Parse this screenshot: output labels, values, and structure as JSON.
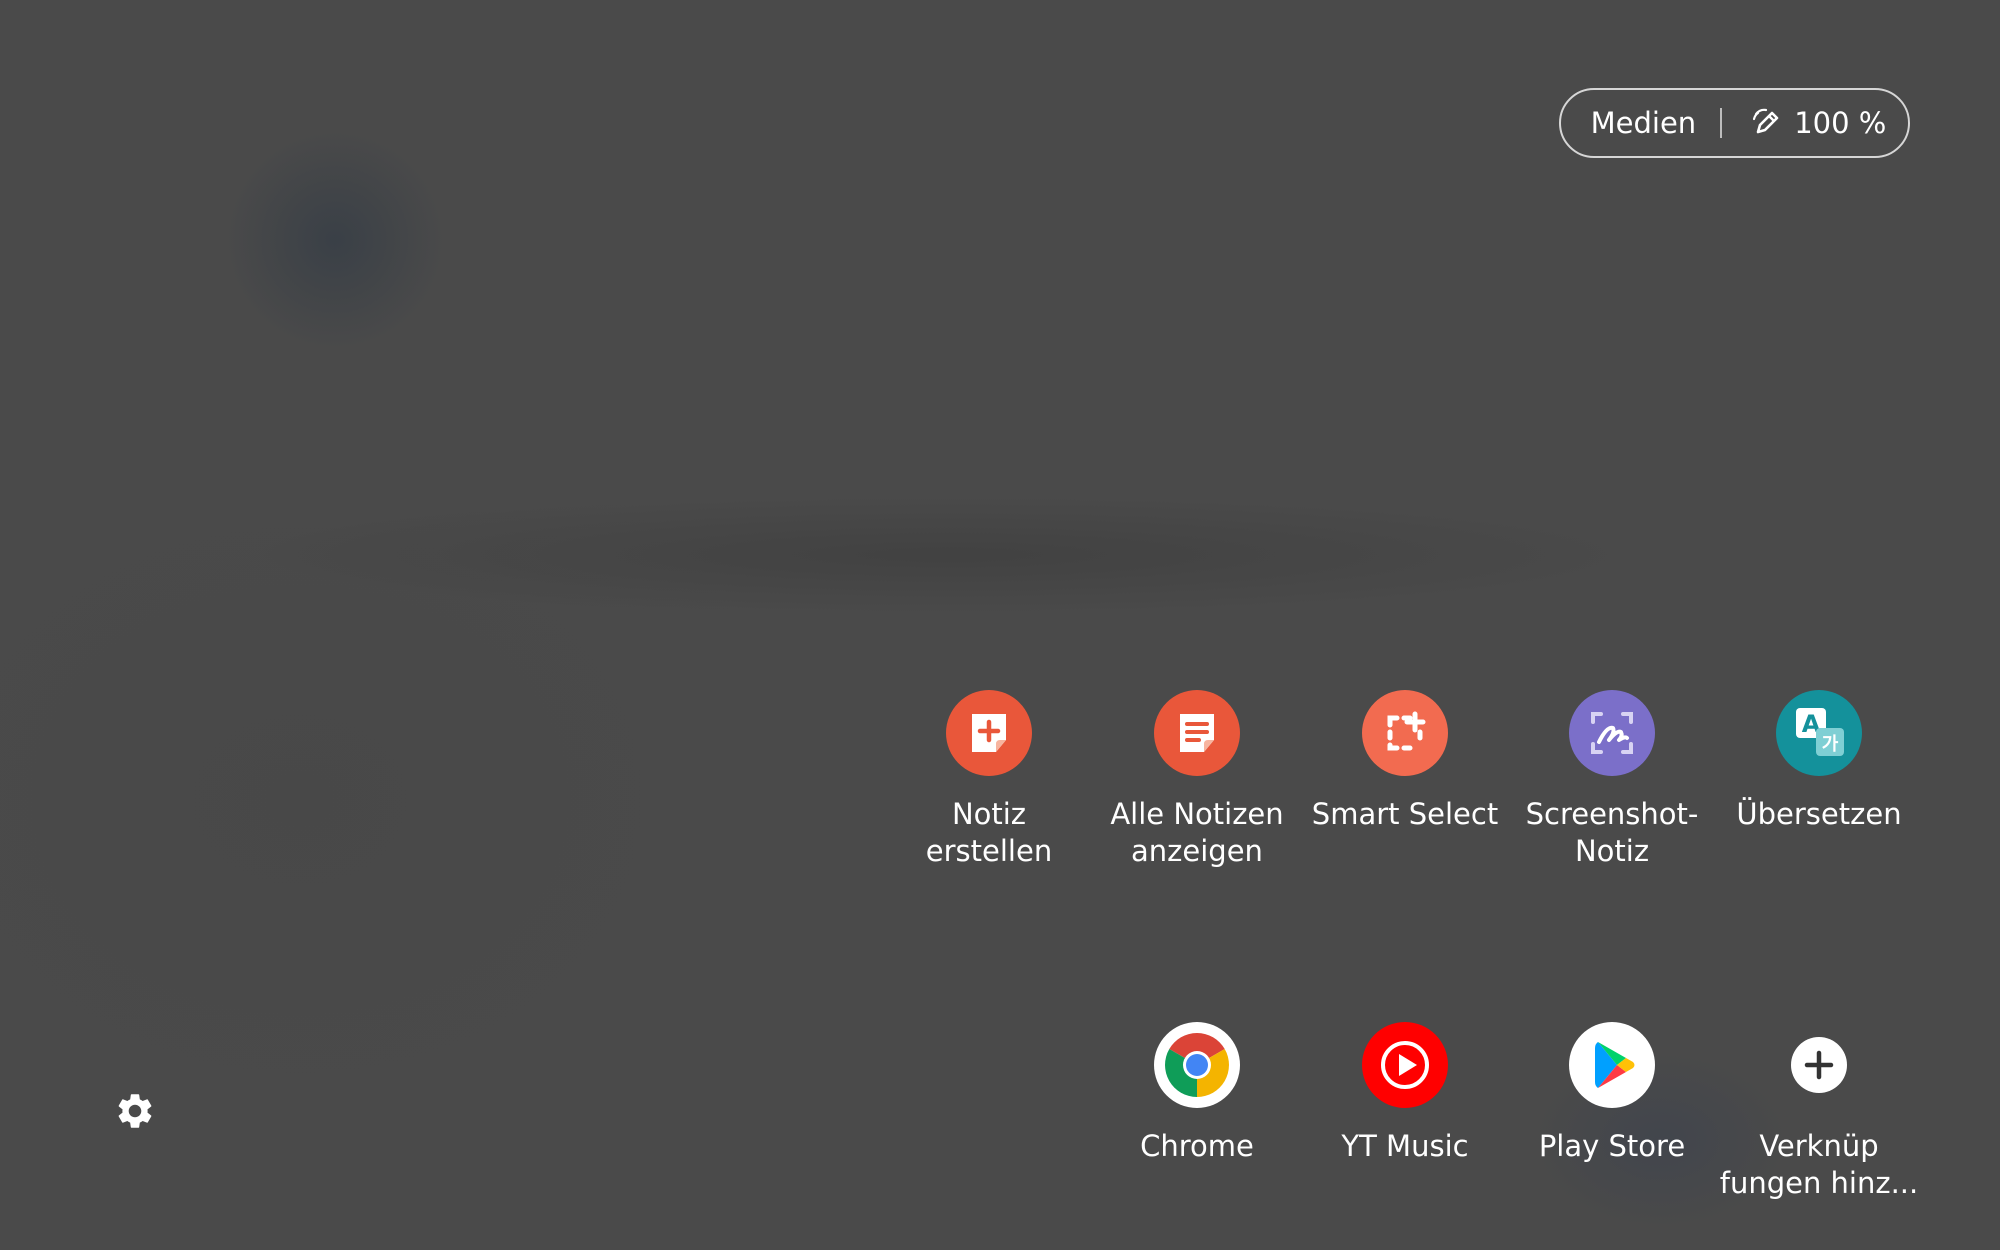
{
  "status": {
    "media_label": "Medien",
    "pen_battery": "100 %"
  },
  "actions": [
    {
      "label": "Notiz\nerstellen",
      "icon": "create-note-icon",
      "color": "#e9573a"
    },
    {
      "label": "Alle Notizen\nanzeigen",
      "icon": "view-notes-icon",
      "color": "#e9573a"
    },
    {
      "label": "Smart Select",
      "icon": "smart-select-icon",
      "color": "#f26b50"
    },
    {
      "label": "Screenshot-\nNotiz",
      "icon": "screen-write-icon",
      "color": "#7b6fc9"
    },
    {
      "label": "Übersetzen",
      "icon": "translate-icon",
      "color": "#14919b"
    }
  ],
  "shortcuts": [
    {
      "label": "Chrome",
      "icon": "chrome-icon"
    },
    {
      "label": "YT Music",
      "icon": "yt-music-icon",
      "color": "#ff0000"
    },
    {
      "label": "Play Store",
      "icon": "play-store-icon"
    },
    {
      "label": "Verknüp\nfungen hinz...",
      "icon": "add-shortcut-icon"
    }
  ],
  "settings_icon": "gear-icon"
}
